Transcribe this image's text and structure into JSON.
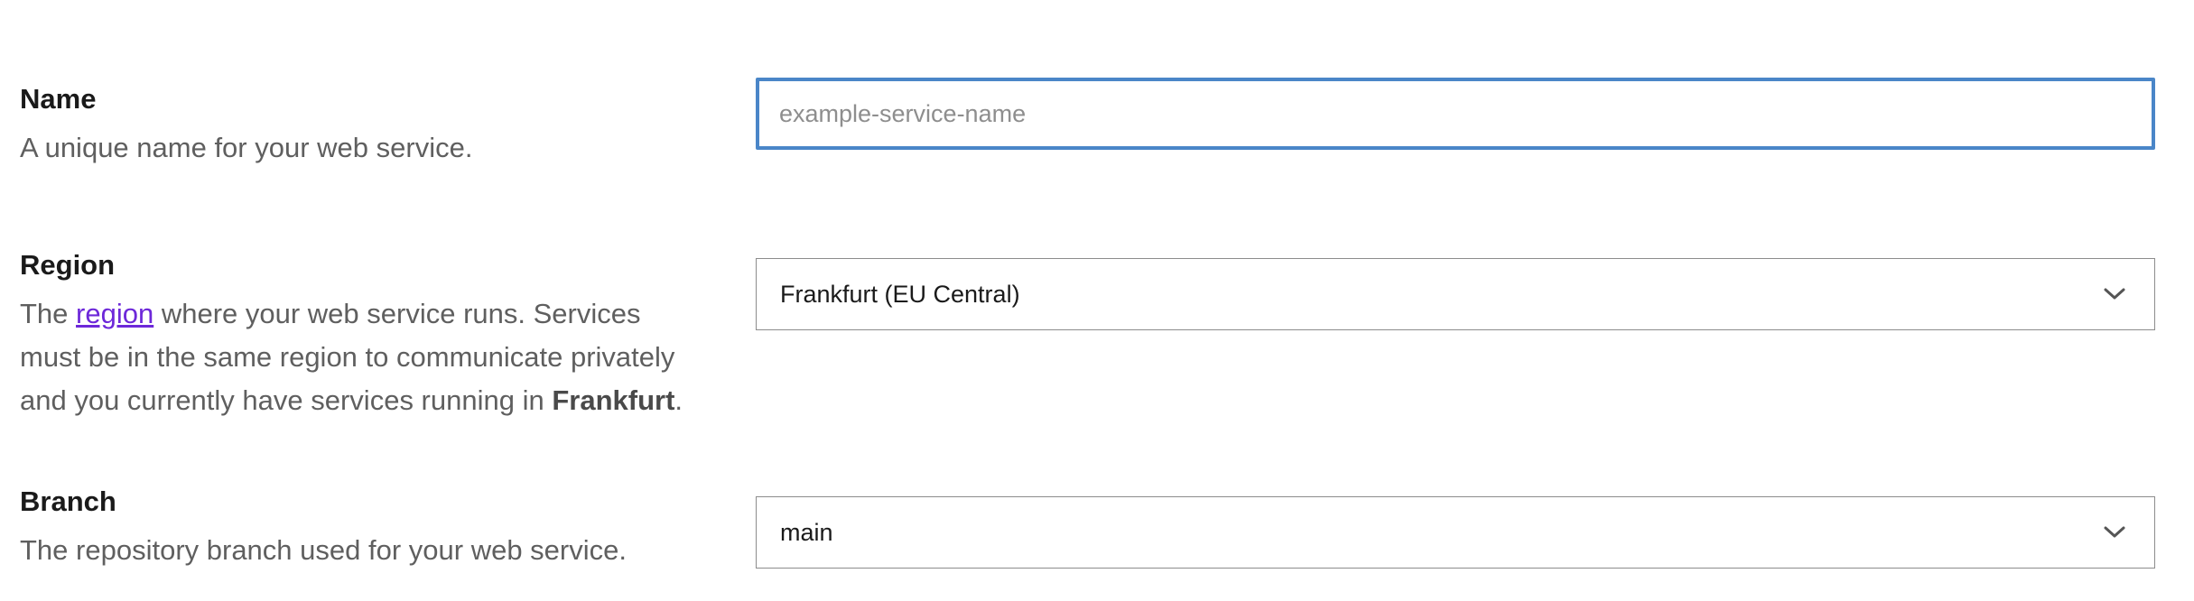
{
  "name_field": {
    "title": "Name",
    "description": "A unique name for your web service.",
    "placeholder": "example-service-name",
    "value": ""
  },
  "region_field": {
    "title": "Region",
    "desc_prefix": "The ",
    "desc_link": "region",
    "desc_middle": " where your web service runs. Services must be in the same region to communicate privately and you currently have services running in ",
    "desc_bold": "Frankfurt",
    "desc_suffix": ".",
    "selected": "Frankfurt (EU Central)",
    "chevron_icon": "chevron-down-icon"
  },
  "branch_field": {
    "title": "Branch",
    "description": "The repository branch used for your web service.",
    "selected": "main",
    "chevron_icon": "chevron-down-icon"
  },
  "colors": {
    "focus_border": "#4a86c8",
    "link": "#6d28d9",
    "muted_text": "#5f5f5f"
  }
}
